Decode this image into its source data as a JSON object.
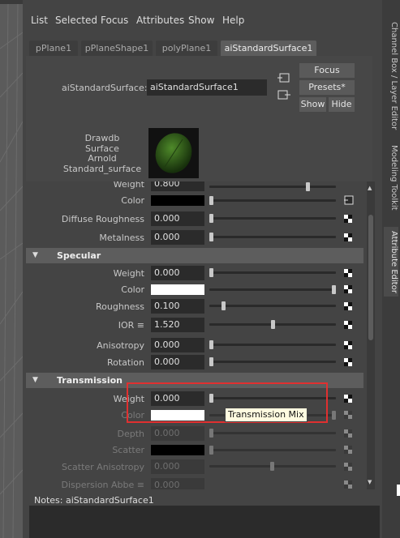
{
  "menubar": [
    "List",
    "Selected",
    "Focus",
    "Attributes",
    "Show",
    "Help"
  ],
  "tabs": [
    "pPlane1",
    "pPlaneShape1",
    "polyPlane1",
    "aiStandardSurface1"
  ],
  "header": {
    "node_label": "aiStandardSurface:",
    "node_name": "aiStandardSurface1",
    "focus": "Focus",
    "presets": "Presets*",
    "show": "Show",
    "hide": "Hide",
    "swatch_caption": [
      "Drawdb",
      "Surface",
      "Arnold",
      "Standard_surface"
    ]
  },
  "base": {
    "weight_label": "Weight",
    "weight_value": "0.800",
    "color_label": "Color",
    "diffuse_roughness_label": "Diffuse Roughness",
    "diffuse_roughness_value": "0.000",
    "metalness_label": "Metalness",
    "metalness_value": "0.000"
  },
  "specular": {
    "title": "Specular",
    "weight_label": "Weight",
    "weight_value": "0.000",
    "color_label": "Color",
    "roughness_label": "Roughness",
    "roughness_value": "0.100",
    "ior_label": "IOR ≡",
    "ior_value": "1.520",
    "anisotropy_label": "Anisotropy",
    "anisotropy_value": "0.000",
    "rotation_label": "Rotation",
    "rotation_value": "0.000"
  },
  "transmission": {
    "title": "Transmission",
    "weight_label": "Weight",
    "weight_value": "0.000",
    "color_label": "Color",
    "depth_label": "Depth",
    "depth_value": "0.000",
    "scatter_label": "Scatter",
    "scatter_anisotropy_label": "Scatter Anisotropy",
    "scatter_anisotropy_value": "0.000",
    "dispersion_label": "Dispersion Abbe ≡",
    "dispersion_value": "0.000"
  },
  "tooltip": "Transmission Mix",
  "notes": "Notes:  aiStandardSurface1",
  "side_tabs": [
    "Channel Box / Layer Editor",
    "Modeling Toolkit",
    "Attribute Editor"
  ]
}
